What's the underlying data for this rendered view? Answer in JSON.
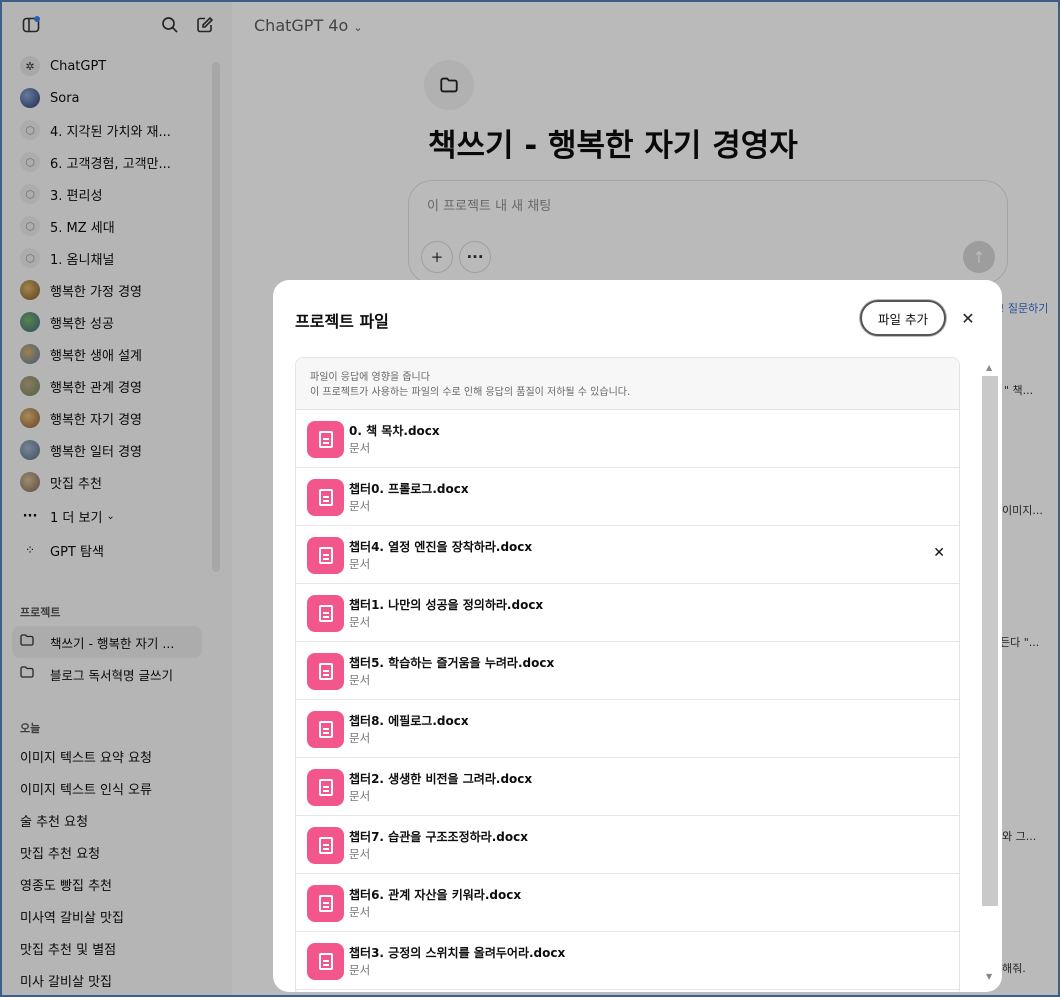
{
  "sidebar": {
    "top_icons": [
      "sidebar-toggle-icon",
      "search-icon",
      "new-chat-icon"
    ],
    "items": [
      {
        "label": "ChatGPT",
        "icon": "chatgpt-logo"
      },
      {
        "label": "Sora",
        "icon": "sora-logo"
      },
      {
        "label": "4. 지각된 가치와 재...",
        "icon": "cube-icon"
      },
      {
        "label": "6. 고객경험, 고객만...",
        "icon": "cube-icon"
      },
      {
        "label": "3. 편리성",
        "icon": "cube-icon"
      },
      {
        "label": "5. MZ 세대",
        "icon": "cube-icon"
      },
      {
        "label": "1. 옴니채널",
        "icon": "cube-icon"
      },
      {
        "label": "행복한 가정 경영",
        "icon": "gpt-avatar"
      },
      {
        "label": "행복한 성공",
        "icon": "gpt-avatar"
      },
      {
        "label": "행복한 생애 설계",
        "icon": "gpt-avatar"
      },
      {
        "label": "행복한 관계 경영",
        "icon": "gpt-avatar"
      },
      {
        "label": "행복한 자기 경영",
        "icon": "gpt-avatar"
      },
      {
        "label": "행복한 일터 경영",
        "icon": "gpt-avatar"
      },
      {
        "label": "맛집 추천",
        "icon": "gpt-avatar"
      }
    ],
    "more_label": "1 더 보기",
    "explore_label": "GPT 탐색",
    "projects_section": "프로젝트",
    "projects": [
      {
        "label": "책쓰기 - 행복한 자기 ...",
        "active": true
      },
      {
        "label": "블로그 독서혁명 글쓰기",
        "active": false
      }
    ],
    "today_section": "오늘",
    "history": [
      "이미지 텍스트 요약 요청",
      "이미지 텍스트 인식 오류",
      "술 추천 요청",
      "맛집 추천 요청",
      "영종도 빵집 추천",
      "미사역 갈비살 맛집",
      "맛집 추천 및 별점",
      "미사 갈비살 맛집"
    ]
  },
  "main": {
    "model_title": "ChatGPT 4o",
    "project_title": "책쓰기 - 행복한 자기 경영자",
    "composer_placeholder": "이 프로젝트 내 새 채팅",
    "bg_fragments": [
      "! 질문하기",
      "\" 책...",
      "이미지...",
      "든다 \"...",
      "와 그...",
      "해줘."
    ]
  },
  "modal": {
    "title": "프로젝트 파일",
    "add_button": "파일 추가",
    "notice_line1": "파일이 응답에 영향을 줍니다",
    "notice_line2": "이 프로젝트가 사용하는 파일의 수로 인해 응답의 품질이 저하될 수 있습니다.",
    "files": [
      {
        "name": "0. 책 목차.docx",
        "type": "문서"
      },
      {
        "name": "챕터0. 프롤로그.docx",
        "type": "문서"
      },
      {
        "name": "챕터4. 열정 엔진을 장착하라.docx",
        "type": "문서",
        "hover": true
      },
      {
        "name": "챕터1. 나만의 성공을 정의하라.docx",
        "type": "문서"
      },
      {
        "name": "챕터5. 학습하는 즐거움을 누려라.docx",
        "type": "문서"
      },
      {
        "name": "챕터8. 에필로그.docx",
        "type": "문서"
      },
      {
        "name": "챕터2. 생생한 비전을 그려라.docx",
        "type": "문서"
      },
      {
        "name": "챕터7. 습관을 구조조정하라.docx",
        "type": "문서"
      },
      {
        "name": "챕터6. 관계 자산을 키워라.docx",
        "type": "문서"
      },
      {
        "name": "챕터3. 긍정의 스위치를 올려두어라.docx",
        "type": "문서"
      }
    ],
    "file_icon_color": "#f3568b"
  }
}
